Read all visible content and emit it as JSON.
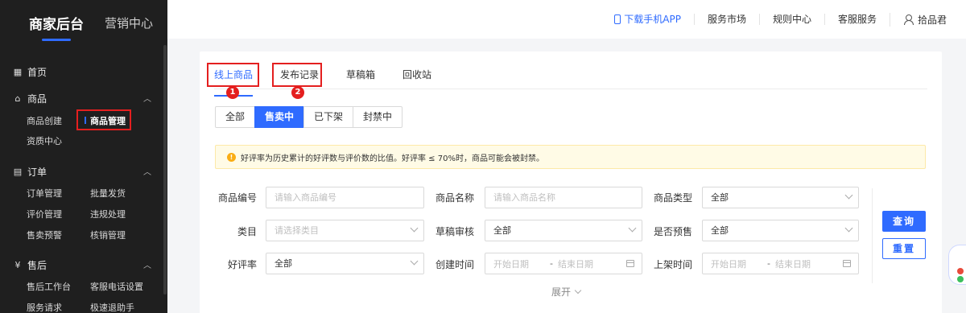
{
  "sidebar": {
    "brand": "商家后台",
    "marketing": "营销中心",
    "home": "首页",
    "groups": [
      {
        "title": "商品",
        "icon": "bag-icon",
        "items": [
          "商品创建",
          "商品管理",
          "资质中心"
        ]
      },
      {
        "title": "订单",
        "icon": "list-icon",
        "items": [
          "订单管理",
          "批量发货",
          "评价管理",
          "违规处理",
          "售卖预警",
          "核销管理"
        ]
      },
      {
        "title": "售后",
        "icon": "yen-icon",
        "items": [
          "售后工作台",
          "客服电话设置",
          "服务请求",
          "极速退助手"
        ]
      }
    ]
  },
  "topbar": {
    "app": "下载手机APP",
    "market": "服务市场",
    "rules": "规则中心",
    "service": "客服服务",
    "user": "拾品君"
  },
  "tabs": [
    "线上商品",
    "发布记录",
    "草稿箱",
    "回收站"
  ],
  "markers": [
    "1",
    "2"
  ],
  "segments": [
    "全部",
    "售卖中",
    "已下架",
    "封禁中"
  ],
  "notice": "好评率为历史累计的好评数与评价数的比值。好评率 ≤ 70%时，商品可能会被封禁。",
  "form": {
    "product_id_label": "商品编号",
    "product_id_ph": "请输入商品编号",
    "product_name_label": "商品名称",
    "product_name_ph": "请输入商品名称",
    "product_type_label": "商品类型",
    "product_type_value": "全部",
    "category_label": "类目",
    "category_ph": "请选择类目",
    "draft_review_label": "草稿审核",
    "draft_review_value": "全部",
    "presale_label": "是否预售",
    "presale_value": "全部",
    "rating_label": "好评率",
    "rating_value": "全部",
    "created_label": "创建时间",
    "listed_label": "上架时间",
    "start_ph": "开始日期",
    "end_ph": "结束日期",
    "dash": "-"
  },
  "buttons": {
    "query": "查询",
    "reset": "重置",
    "expand": "展开"
  }
}
